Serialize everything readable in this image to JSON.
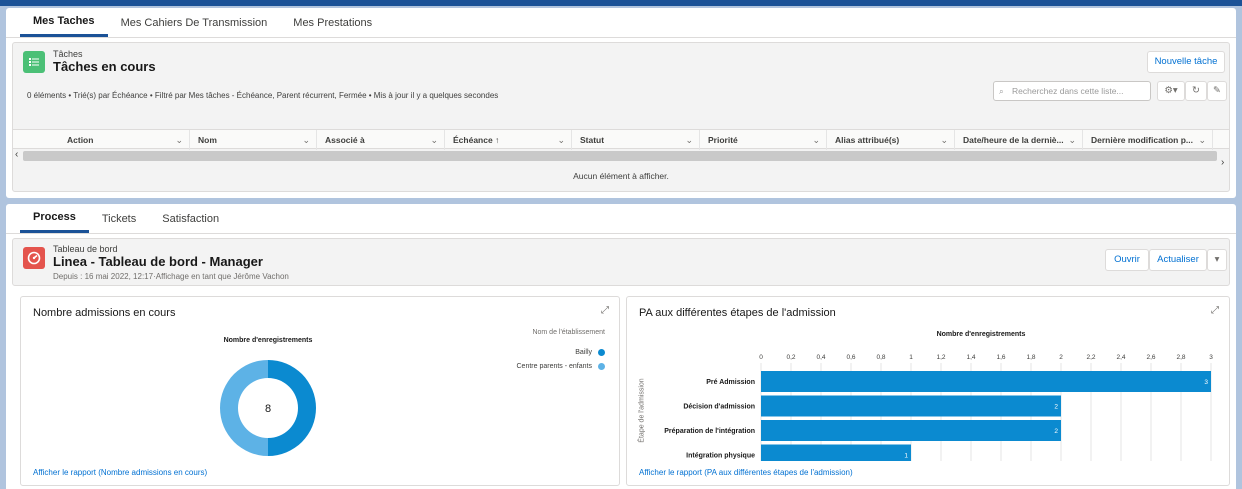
{
  "top_tabs": [
    "Mes Taches",
    "Mes Cahiers De Transmission",
    "Mes Prestations"
  ],
  "tasks": {
    "object_label": "Tâches",
    "title": "Tâches en cours",
    "new_button": "Nouvelle tâche",
    "meta": "0 éléments • Trié(s) par Échéance • Filtré par Mes tâches - Échéance, Parent récurrent, Fermée • Mis à jour il y a quelques secondes",
    "search_placeholder": "Recherchez dans cette liste...",
    "columns": [
      "Action",
      "Nom",
      "Associé à",
      "Échéance ↑",
      "Statut",
      "Priorité",
      "Alias attribué(s)",
      "Date/heure de la derniè...",
      "Dernière modification p..."
    ],
    "empty_message": "Aucun élément à afficher."
  },
  "bottom_tabs": [
    "Process",
    "Tickets",
    "Satisfaction"
  ],
  "dashboard": {
    "object_label": "Tableau de bord",
    "title": "Linea - Tableau de bord - Manager",
    "meta": "Depuis : 16 mai 2022, 12:17·Affichage en tant que Jérôme Vachon",
    "open_button": "Ouvrir",
    "refresh_button": "Actualiser"
  },
  "admissions_widget": {
    "title": "Nombre admissions en cours",
    "report_link": "Afficher le rapport (Nombre admissions en cours)",
    "chart_data": {
      "type": "pie",
      "title": "Nombre d'enregistrements",
      "total": "8",
      "legend_title": "Nom de l'établissement",
      "legend_placement": "right",
      "slices": [
        {
          "name": "Bailly",
          "color": "#0b8ad0"
        },
        {
          "name": "Centre parents - enfants",
          "color": "#5db2e6"
        }
      ],
      "values": [
        4,
        4
      ]
    }
  },
  "pa_widget": {
    "title": "PA aux différentes étapes de l'admission",
    "report_link": "Afficher le rapport (PA aux différentes étapes de l'admission)",
    "chart_data": {
      "type": "bar",
      "orientation": "horizontal",
      "title": "Nombre d'enregistrements",
      "ylabel": "Étape de l'admission",
      "categories": [
        "Pré Admission",
        "Décision d'admission",
        "Préparation de l'intégration",
        "Intégration physique"
      ],
      "values": [
        3,
        2,
        2,
        1
      ],
      "data_labels": [
        "3",
        "2",
        "2",
        "1"
      ],
      "xlim": [
        0,
        3
      ],
      "ticks": [
        "0",
        "0,2",
        "0,4",
        "0,6",
        "0,8",
        "1",
        "1,2",
        "1,4",
        "1,6",
        "1,8",
        "2",
        "2,2",
        "2,4",
        "2,6",
        "2,8",
        "3"
      ],
      "tick_values": [
        0,
        0.2,
        0.4,
        0.6,
        0.8,
        1,
        1.2,
        1.4,
        1.6,
        1.8,
        2,
        2.2,
        2.4,
        2.6,
        2.8,
        3
      ],
      "bar_color": "#0b8ad0",
      "grid": true
    }
  }
}
